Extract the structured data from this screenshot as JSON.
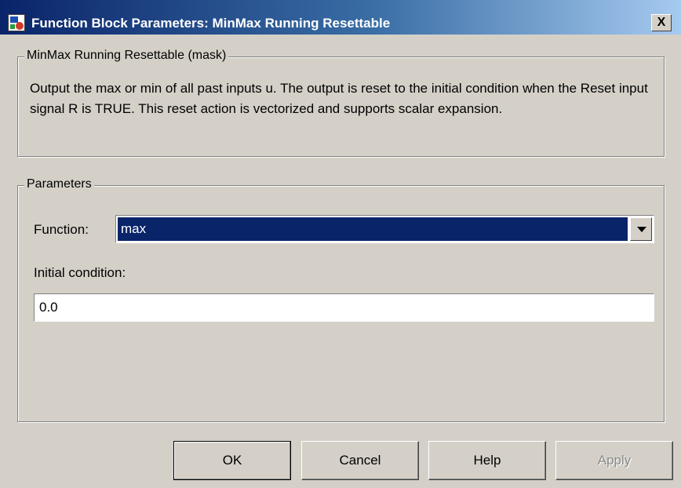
{
  "window": {
    "title": "Function Block Parameters: MinMax Running Resettable",
    "close_label": "X"
  },
  "mask_group": {
    "legend": "MinMax Running Resettable (mask)",
    "description": "Output the max or min of all past inputs u.  The output is reset to the initial condition when the Reset input signal R is TRUE.  This reset action is vectorized and supports scalar expansion."
  },
  "parameters_group": {
    "legend": "Parameters",
    "function_label": "Function:",
    "function_value": "max",
    "initial_condition_label": "Initial condition:",
    "initial_condition_value": "0.0"
  },
  "buttons": {
    "ok": "OK",
    "cancel": "Cancel",
    "help": "Help",
    "apply": "Apply"
  },
  "icons": {
    "app": "simulink-block-icon",
    "close": "close-icon",
    "dropdown": "chevron-down-icon"
  },
  "colors": {
    "title_bar_start": "#0a246a",
    "title_bar_end": "#a6caf0",
    "selection": "#0a246a",
    "dialog_face": "#d4d0c8"
  }
}
